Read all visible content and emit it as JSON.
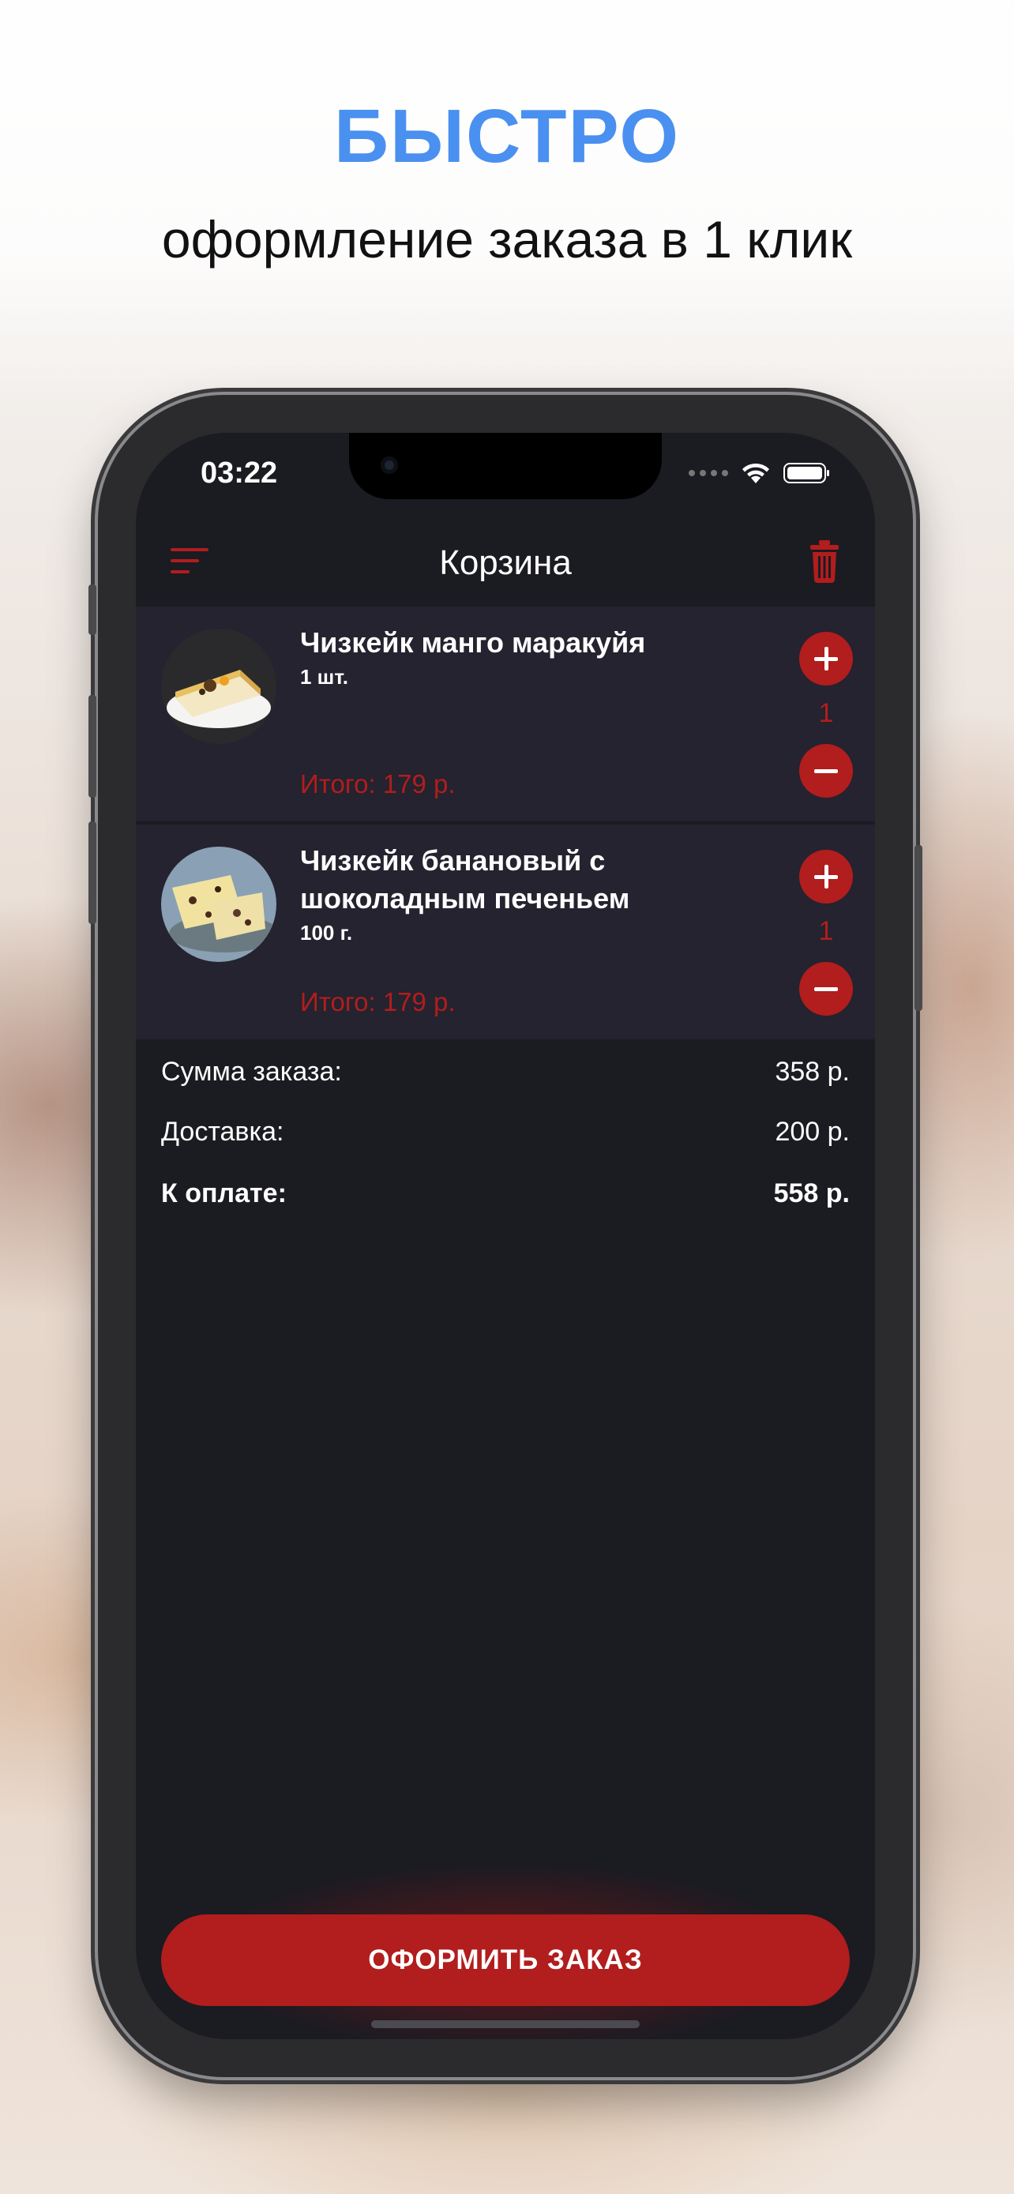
{
  "promo": {
    "headline": "БЫСТРО",
    "subheadline": "оформление заказа в 1 клик"
  },
  "status_bar": {
    "time": "03:22"
  },
  "app_bar": {
    "title": "Корзина",
    "menu_icon": "menu-icon",
    "trash_icon": "trash-icon"
  },
  "cart": {
    "items": [
      {
        "title": "Чизкейк манго маракуйя",
        "portion": "1 шт.",
        "total": "Итого: 179 р.",
        "quantity": "1"
      },
      {
        "title": "Чизкейк банановый с шоколадным печеньем",
        "portion": "100 г.",
        "total": "Итого: 179 р.",
        "quantity": "1"
      }
    ]
  },
  "summary": {
    "subtotal_label": "Сумма заказа:",
    "subtotal_value": "358 р.",
    "delivery_label": "Доставка:",
    "delivery_value": "200 р.",
    "total_label": "К оплате:",
    "total_value": "558 р."
  },
  "checkout": {
    "label": "ОФОРМИТЬ ЗАКАЗ"
  },
  "colors": {
    "accent": "#b21d1d",
    "headline": "#4a90f0",
    "screen_bg": "#1b1b22",
    "item_bg": "#24232f"
  }
}
